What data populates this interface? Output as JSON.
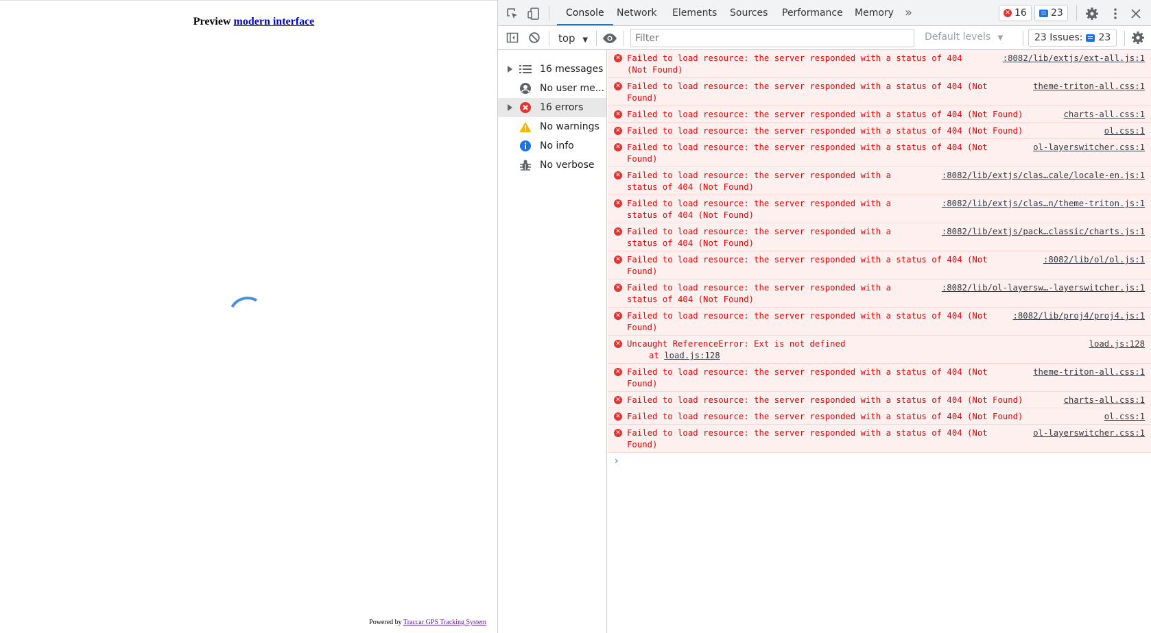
{
  "page": {
    "preview_prefix": "Preview",
    "preview_link": "modern interface",
    "powered_prefix": "Powered by",
    "powered_link": "Traccar GPS Tracking System"
  },
  "devtools": {
    "tabs": [
      "Console",
      "Network",
      "Elements",
      "Sources",
      "Performance",
      "Memory"
    ],
    "more_tabs": "»",
    "error_count": "16",
    "message_count": "23",
    "context": "top",
    "filter_placeholder": "Filter",
    "levels": "Default levels",
    "issues_label": "23 Issues:",
    "issues_count": "23",
    "sidebar": [
      {
        "label": "16 messages",
        "icon": "list-icon"
      },
      {
        "label": "No user me...",
        "icon": "user-icon"
      },
      {
        "label": "16 errors",
        "icon": "error-icon"
      },
      {
        "label": "No warnings",
        "icon": "warning-icon"
      },
      {
        "label": "No info",
        "icon": "info-icon"
      },
      {
        "label": "No verbose",
        "icon": "bug-icon"
      }
    ],
    "messages": [
      {
        "text": "Failed to load resource: the server responded with a status of 404 (Not Found)",
        "source": ":8082/lib/extjs/ext-all.js:1"
      },
      {
        "text": "Failed to load resource: the server responded with a status of 404 (Not Found)",
        "source": "theme-triton-all.css:1"
      },
      {
        "text": "Failed to load resource: the server responded with a status of 404 (Not Found)",
        "source": "charts-all.css:1"
      },
      {
        "text": "Failed to load resource: the server responded with a status of 404 (Not Found)",
        "source": "ol.css:1"
      },
      {
        "text": "Failed to load resource: the server responded with a status of 404 (Not Found)",
        "source": "ol-layerswitcher.css:1"
      },
      {
        "text": "Failed to load resource: the server responded with a status of 404 (Not Found)",
        "source": ":8082/lib/extjs/clas…cale/locale-en.js:1"
      },
      {
        "text": "Failed to load resource: the server responded with a status of 404 (Not Found)",
        "source": ":8082/lib/extjs/clas…n/theme-triton.js:1"
      },
      {
        "text": "Failed to load resource: the server responded with a status of 404 (Not Found)",
        "source": ":8082/lib/extjs/pack…classic/charts.js:1"
      },
      {
        "text": "Failed to load resource: the server responded with a status of 404 (Not Found)",
        "source": ":8082/lib/ol/ol.js:1"
      },
      {
        "text": "Failed to load resource: the server responded with a status of 404 (Not Found)",
        "source": ":8082/lib/ol-layersw…-layerswitcher.js:1"
      },
      {
        "text": "Failed to load resource: the server responded with a status of 404 (Not Found)",
        "source": ":8082/lib/proj4/proj4.js:1"
      },
      {
        "text": "Uncaught ReferenceError: Ext is not defined",
        "source": "load.js:128",
        "at": "load.js:128"
      },
      {
        "text": "Failed to load resource: the server responded with a status of 404 (Not Found)",
        "source": "theme-triton-all.css:1"
      },
      {
        "text": "Failed to load resource: the server responded with a status of 404 (Not Found)",
        "source": "charts-all.css:1"
      },
      {
        "text": "Failed to load resource: the server responded with a status of 404 (Not Found)",
        "source": "ol.css:1"
      },
      {
        "text": "Failed to load resource: the server responded with a status of 404 (Not Found)",
        "source": "ol-layerswitcher.css:1"
      }
    ],
    "at_prefix": "at",
    "prompt": "›"
  }
}
